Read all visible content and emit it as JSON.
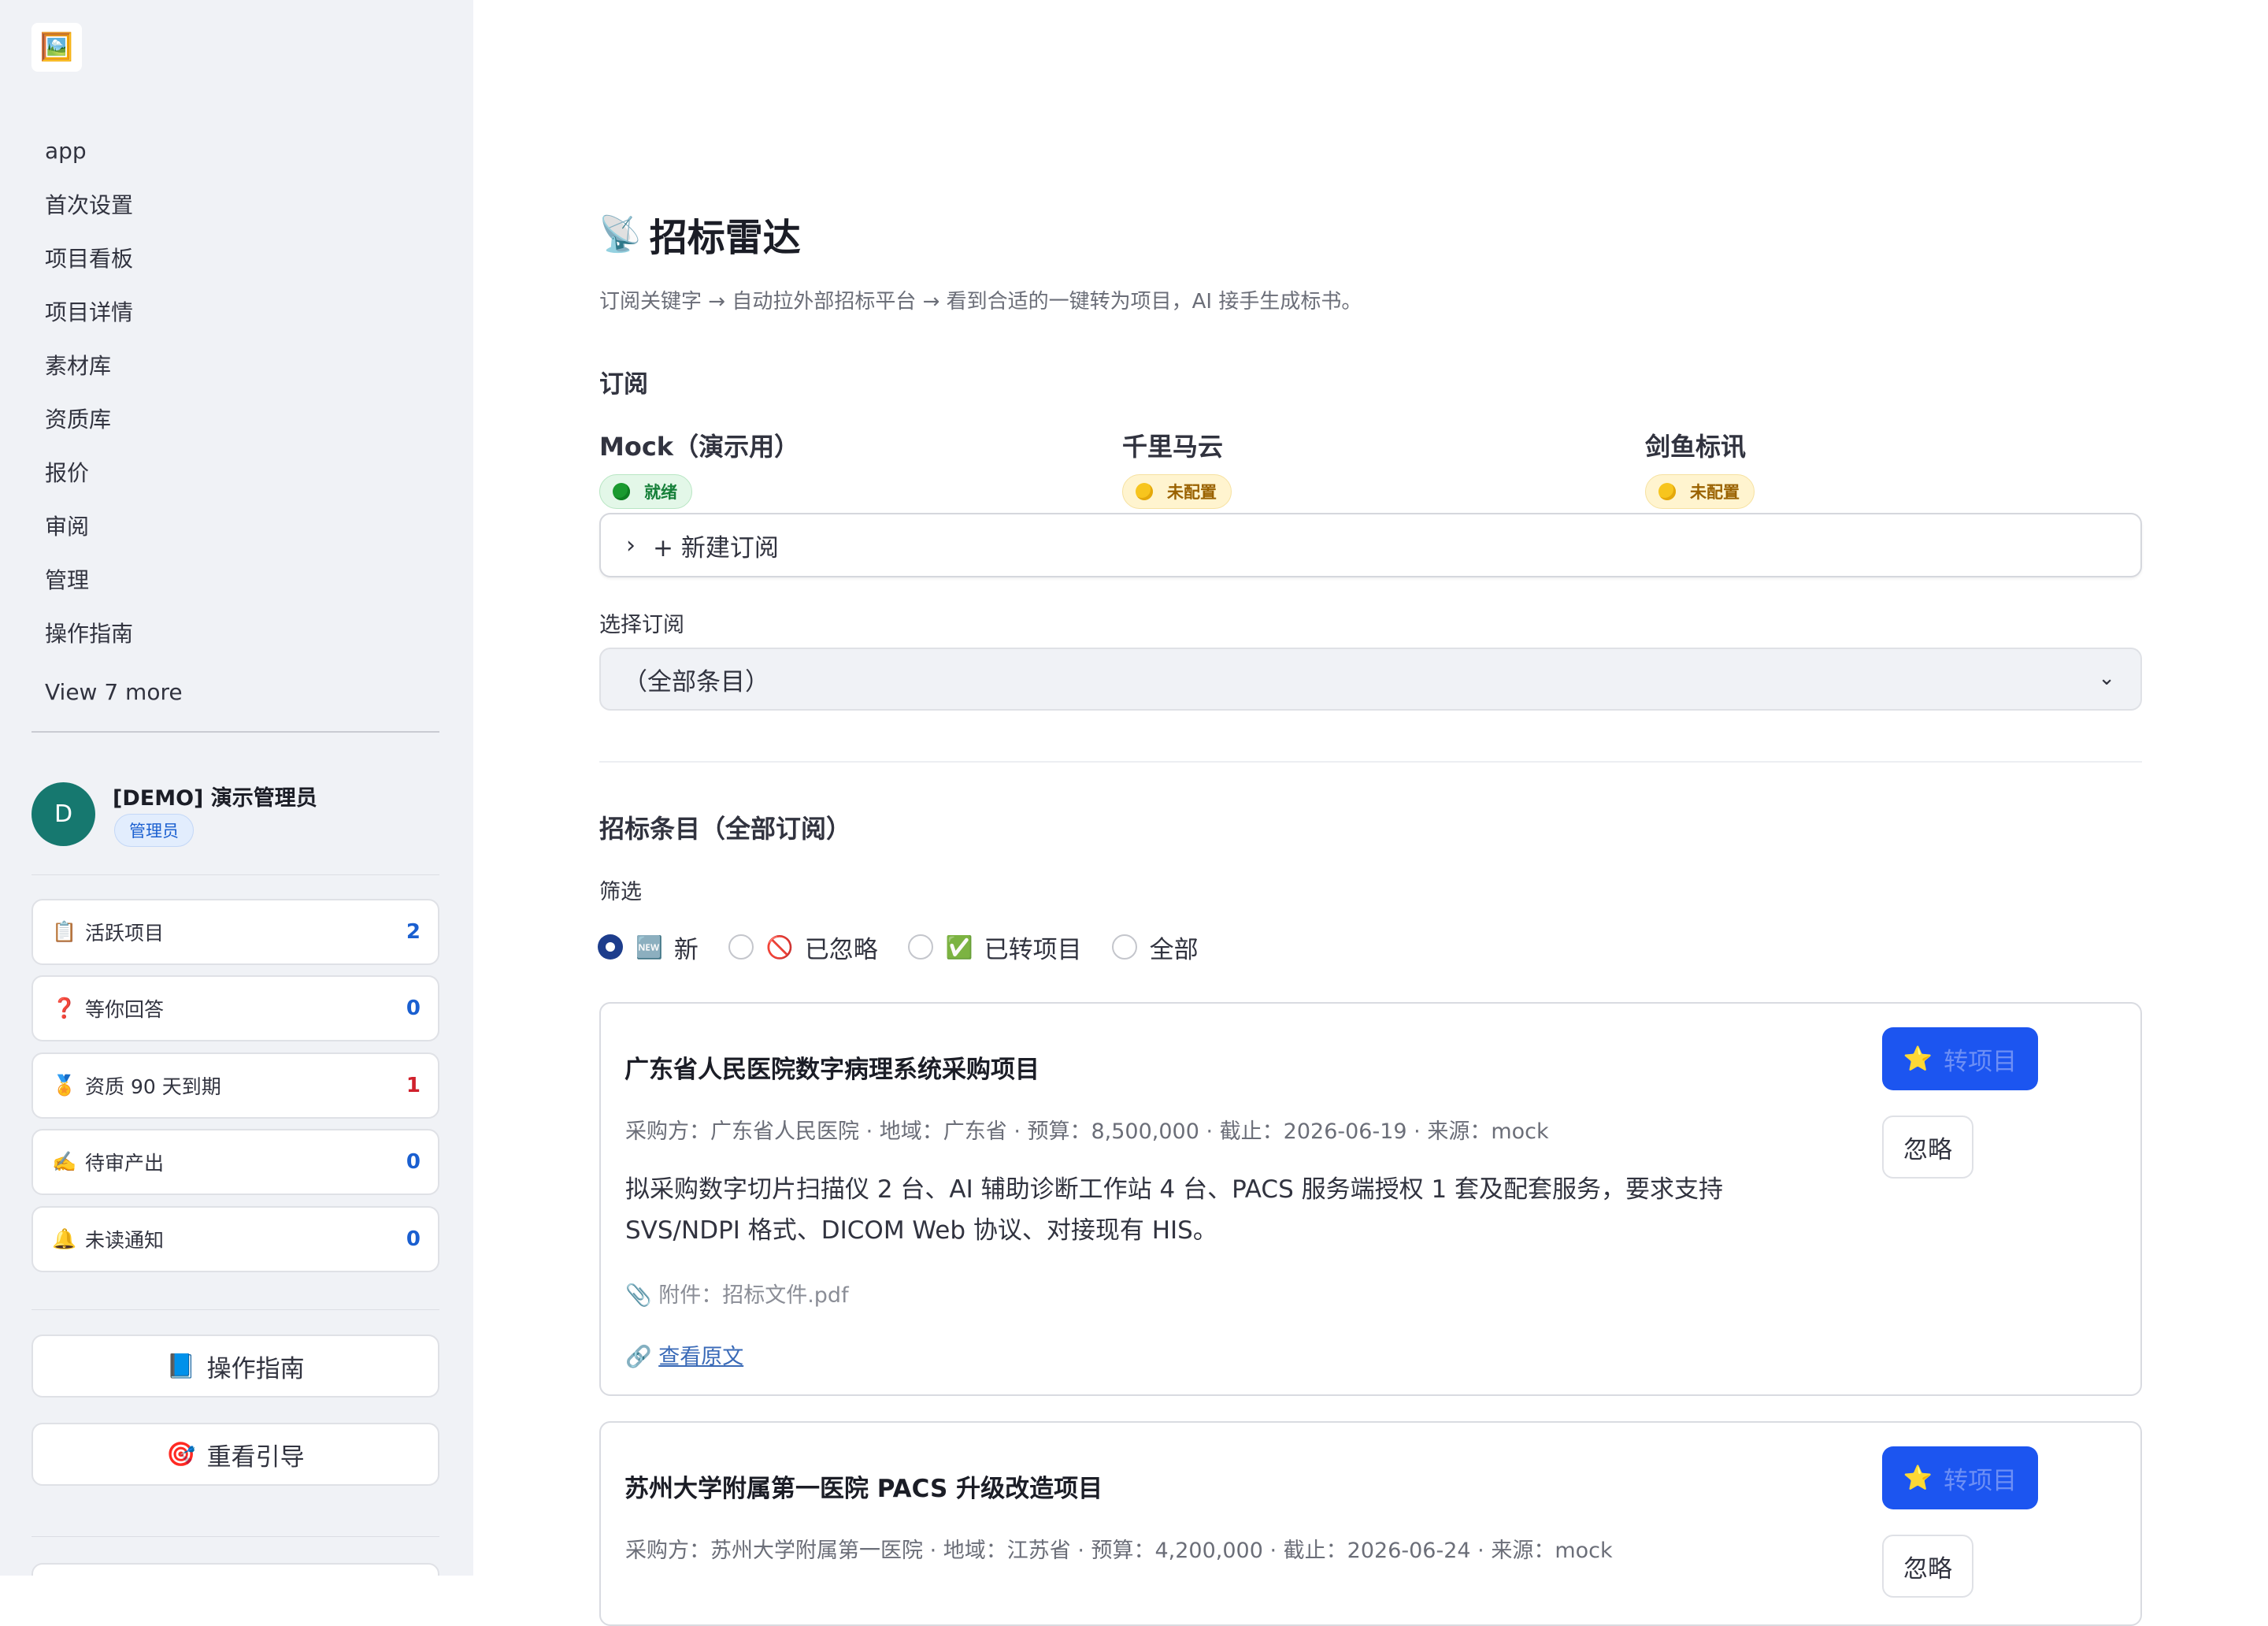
{
  "sidebar": {
    "logo_icon": "image-icon",
    "nav": [
      "app",
      "首次设置",
      "项目看板",
      "项目详情",
      "素材库",
      "资质库",
      "报价",
      "审阅",
      "管理",
      "操作指南"
    ],
    "view_more": "View 7 more",
    "user": {
      "initial": "D",
      "name": "[DEMO] 演示管理员",
      "role": "管理员"
    },
    "stats": [
      {
        "icon": "📋",
        "label": "活跃项目",
        "count": "2"
      },
      {
        "icon": "❓",
        "label": "等你回答",
        "count": "0"
      },
      {
        "icon": "🏅",
        "label": "资质 90 天到期",
        "count": "1"
      },
      {
        "icon": "✍️",
        "label": "待审产出",
        "count": "0"
      },
      {
        "icon": "🔔",
        "label": "未读通知",
        "count": "0"
      }
    ],
    "buttons": [
      {
        "icon": "📘",
        "label": "操作指南"
      },
      {
        "icon": "🎯",
        "label": "重看引导"
      }
    ]
  },
  "main": {
    "title_icon": "📡",
    "title": "招标雷达",
    "subtitle": "订阅关键字 → 自动拉外部招标平台 → 看到合适的一键转为项目，AI 接手生成标书。",
    "subs_heading": "订阅",
    "sources": [
      {
        "name": "Mock（演示用）",
        "status": "就绪",
        "state": "ok"
      },
      {
        "name": "千里马云",
        "status": "未配置",
        "state": "warn"
      },
      {
        "name": "剑鱼标讯",
        "status": "未配置",
        "state": "warn"
      }
    ],
    "new_sub": "+ 新建订阅",
    "select_label": "选择订阅",
    "select_value": "（全部条目）",
    "items_heading": "招标条目（全部订阅）",
    "filter_label": "筛选",
    "filters": [
      {
        "icon": "🆕",
        "label": "新",
        "selected": true
      },
      {
        "icon": "🚫",
        "label": "已忽略",
        "selected": false
      },
      {
        "icon": "✅",
        "label": "已转项目",
        "selected": false
      },
      {
        "icon": "",
        "label": "全部",
        "selected": false
      }
    ],
    "convert_icon": "⭐",
    "convert_label": "转项目",
    "ignore_label": "忽略",
    "items": [
      {
        "title": "广东省人民医院数字病理系统采购项目",
        "meta": "采购方：广东省人民医院 · 地域：广东省 · 预算：8,500,000 · 截止：2026-06-19 · 来源：mock",
        "desc": "拟采购数字切片扫描仪 2 台、AI 辅助诊断工作站 4 台、PACS 服务端授权 1 套及配套服务，要求支持 SVS/NDPI 格式、DICOM Web 协议、对接现有 HIS。",
        "attachment": "附件：招标文件.pdf",
        "link": "查看原文"
      },
      {
        "title": "苏州大学附属第一医院 PACS 升级改造项目",
        "meta": "采购方：苏州大学附属第一医院 · 地域：江苏省 · 预算：4,200,000 · 截止：2026-06-24 · 来源：mock"
      }
    ]
  }
}
